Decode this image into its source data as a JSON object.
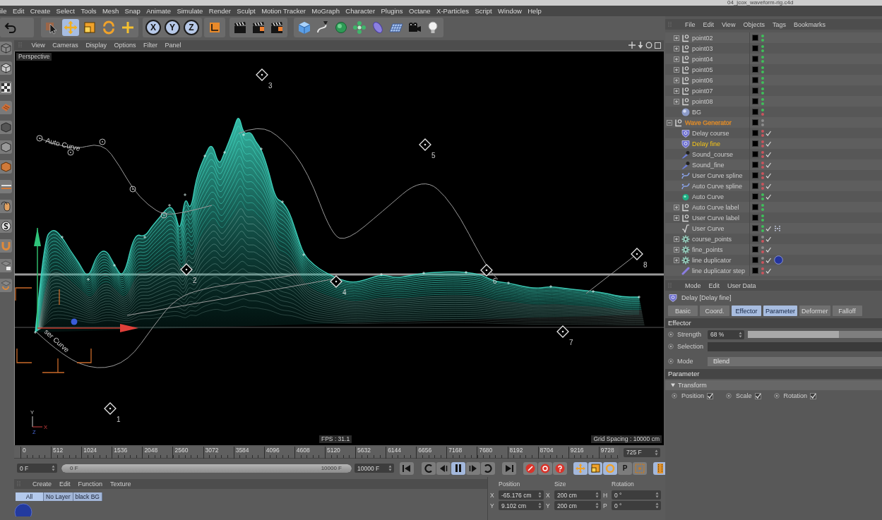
{
  "window": {
    "title": "04_jcox_waveform-rig.c4d"
  },
  "menu_bar": [
    "ile",
    "Edit",
    "Create",
    "Select",
    "Tools",
    "Mesh",
    "Snap",
    "Animate",
    "Simulate",
    "Render",
    "Sculpt",
    "Motion Tracker",
    "MoGraph",
    "Character",
    "Plugins",
    "Octane",
    "X-Particles",
    "Script",
    "Window",
    "Help"
  ],
  "toolbar": {
    "tools": [
      {
        "kind": "live-selection",
        "selected": false
      },
      {
        "kind": "move",
        "selected": true
      },
      {
        "kind": "scale",
        "selected": false
      },
      {
        "kind": "rotate",
        "selected": false
      },
      {
        "kind": "add",
        "selected": false
      }
    ],
    "axis_locks": [
      {
        "label": "X",
        "on": true
      },
      {
        "label": "Y",
        "on": true
      },
      {
        "label": "Z",
        "on": true
      }
    ]
  },
  "viewport": {
    "menu": [
      "View",
      "Cameras",
      "Display",
      "Options",
      "Filter",
      "Panel"
    ],
    "camera": "Perspective",
    "curve_labels": [
      "Auto Curve",
      "ser Curve"
    ],
    "markers": [
      "1",
      "2",
      "3",
      "4",
      "5",
      "6",
      "7",
      "8"
    ],
    "axis_labels": [
      "Y",
      "X",
      "Z"
    ],
    "fps": "FPS : 31.1",
    "grid_spacing": "Grid Spacing : 10000 cm"
  },
  "timeline": {
    "ticks": [
      "0",
      "512",
      "1024",
      "1536",
      "2048",
      "2560",
      "3072",
      "3584",
      "4096",
      "4608",
      "5120",
      "5632",
      "6144",
      "6656",
      "7168",
      "7680",
      "8192",
      "8704",
      "9216",
      "9728"
    ],
    "current_frame": "725 F"
  },
  "transport": {
    "start_frame": "0 F",
    "range": {
      "start": "0 F",
      "end": "10000 F",
      "level": 1
    },
    "end_frame": "10000 F",
    "buttons": [
      {
        "kind": "first-frame",
        "on": false
      },
      {
        "kind": "previous-key",
        "on": false
      },
      {
        "kind": "play-backward",
        "on": false
      },
      {
        "kind": "pause",
        "on": true
      },
      {
        "kind": "play-forward",
        "on": false
      },
      {
        "kind": "next-key",
        "on": false
      },
      {
        "kind": "last-frame",
        "on": false
      }
    ],
    "key_channels": [
      {
        "kind": "move",
        "on": true
      },
      {
        "kind": "scale",
        "on": true
      },
      {
        "kind": "rotate",
        "on": true
      },
      {
        "kind": "parameter",
        "label": "P",
        "on": false
      },
      {
        "kind": "points",
        "on": false
      }
    ]
  },
  "materials": {
    "menu": [
      "Create",
      "Edit",
      "Function",
      "Texture"
    ],
    "layers": [
      {
        "label": "All",
        "selected": true
      },
      {
        "label": "No Layer",
        "selected": false
      },
      {
        "label": "black BG",
        "selected": false
      }
    ]
  },
  "coordinates": {
    "headers": [
      "Position",
      "Size",
      "Rotation"
    ],
    "rows": [
      [
        {
          "axis": "X",
          "value": "-65.176 cm"
        },
        {
          "axis": "X",
          "value": "200 cm"
        },
        {
          "axis": "H",
          "value": "0 °"
        }
      ],
      [
        {
          "axis": "Y",
          "value": "9.102 cm"
        },
        {
          "axis": "Y",
          "value": "200 cm"
        },
        {
          "axis": "P",
          "value": "0 °"
        }
      ]
    ]
  },
  "objects": {
    "menu": [
      "File",
      "Edit",
      "View",
      "Objects",
      "Tags",
      "Bookmarks"
    ],
    "tree": [
      {
        "children": [
          {
            "name": "point02",
            "kind": "null",
            "expanded": false,
            "selected": false,
            "visibility": [
              {
                "color": "#3fbf5a"
              },
              {
                "color": "#3fbf5a"
              }
            ]
          },
          {
            "name": "point03",
            "kind": "null",
            "expanded": false,
            "selected": false,
            "visibility": [
              {
                "color": "#3fbf5a"
              },
              {
                "color": "#3fbf5a"
              }
            ]
          },
          {
            "name": "point04",
            "kind": "null",
            "expanded": false,
            "selected": false,
            "visibility": [
              {
                "color": "#3fbf5a"
              },
              {
                "color": "#3fbf5a"
              }
            ]
          },
          {
            "name": "point05",
            "kind": "null",
            "expanded": false,
            "selected": false,
            "visibility": [
              {
                "color": "#3fbf5a"
              },
              {
                "color": "#3fbf5a"
              }
            ]
          },
          {
            "name": "point06",
            "kind": "null",
            "expanded": false,
            "selected": false,
            "visibility": [
              {
                "color": "#3fbf5a"
              },
              {
                "color": "#3fbf5a"
              }
            ]
          },
          {
            "name": "point07",
            "kind": "null",
            "expanded": false,
            "selected": false,
            "visibility": [
              {
                "color": "#3fbf5a"
              },
              {
                "color": "#3fbf5a"
              }
            ]
          },
          {
            "name": "point08",
            "kind": "null",
            "expanded": false,
            "selected": false,
            "visibility": [
              {
                "color": "#3fbf5a"
              },
              {
                "color": "#3fbf5a"
              }
            ]
          },
          {
            "name": "BG",
            "kind": "sphere",
            "selected": false,
            "visibility": [
              {
                "color": "#3fbf5a"
              },
              {
                "color": "#c9545d"
              }
            ]
          }
        ]
      },
      {
        "name": "Wave Generator",
        "kind": "null",
        "expanded": true,
        "selected": false,
        "color": "#d8892c",
        "visibility": [
          {
            "color": "#8c8c8c"
          },
          {
            "color": "#8c8c8c"
          }
        ],
        "children": [
          {
            "name": "Delay course",
            "kind": "effector",
            "selected": false,
            "visibility": [
              {
                "color": "#c9545d"
              },
              {
                "color": "#c9545d"
              }
            ],
            "enabled": true
          },
          {
            "name": "Delay fine",
            "kind": "effector",
            "selected": true,
            "visibility": [
              {
                "color": "#c9545d"
              },
              {
                "color": "#c9545d"
              }
            ],
            "enabled": true
          },
          {
            "name": "Sound_course",
            "kind": "sound",
            "selected": false,
            "visibility": [
              {
                "color": "#c9545d"
              },
              {
                "color": "#c9545d"
              }
            ],
            "enabled": true
          },
          {
            "name": "Sound_fine",
            "kind": "sound",
            "selected": false,
            "visibility": [
              {
                "color": "#c9545d"
              },
              {
                "color": "#c9545d"
              }
            ],
            "enabled": true
          },
          {
            "name": "User Curve spline",
            "kind": "spline",
            "selected": false,
            "visibility": [
              {
                "color": "#c9545d"
              },
              {
                "color": "#c9545d"
              }
            ],
            "enabled": true
          },
          {
            "name": "Auto Curve spline",
            "kind": "spline",
            "selected": false,
            "visibility": [
              {
                "color": "#c9545d"
              },
              {
                "color": "#c9545d"
              }
            ],
            "enabled": true
          },
          {
            "name": "Auto Curve",
            "kind": "ball",
            "selected": false,
            "visibility": [
              {
                "color": "#3fbf5a"
              },
              {
                "color": "#3fbf5a"
              }
            ],
            "enabled": true
          },
          {
            "name": "Auto Curve label",
            "kind": "null",
            "expanded": false,
            "selected": false,
            "visibility": [
              {
                "color": "#3fbf5a"
              },
              {
                "color": "#3fbf5a"
              }
            ]
          },
          {
            "name": "User Curve label",
            "kind": "null",
            "expanded": false,
            "selected": false,
            "visibility": [
              {
                "color": "#3fbf5a"
              },
              {
                "color": "#3fbf5a"
              }
            ]
          },
          {
            "name": "User Curve",
            "kind": "formula",
            "selected": false,
            "visibility": [
              {
                "color": "#3fbf5a"
              },
              {
                "color": "#3fbf5a"
              }
            ],
            "enabled": true,
            "tags": [
              {
                "kind": "points"
              }
            ]
          },
          {
            "name": "course_points",
            "kind": "gear",
            "expanded": false,
            "selected": false,
            "visibility": [
              {
                "color": "#8c8c8c"
              },
              {
                "color": "#c9545d"
              }
            ],
            "enabled": true
          },
          {
            "name": "fine_points",
            "kind": "gear",
            "expanded": false,
            "selected": false,
            "visibility": [
              {
                "color": "#8c8c8c"
              },
              {
                "color": "#c9545d"
              }
            ],
            "enabled": true
          },
          {
            "name": "line duplicator",
            "kind": "gear",
            "expanded": false,
            "selected": false,
            "visibility": [
              {
                "color": "#8c8c8c"
              },
              {
                "color": "#c9545d"
              }
            ],
            "enabled": true,
            "tags": [
              {
                "kind": "material"
              }
            ]
          },
          {
            "name": "line duplicator step",
            "kind": "stroke",
            "selected": false,
            "visibility": [
              {
                "color": "#c9545d"
              },
              {
                "color": "#c9545d"
              }
            ],
            "enabled": true
          }
        ]
      }
    ]
  },
  "attributes": {
    "menu": [
      "Mode",
      "Edit",
      "User Data"
    ],
    "title": "Delay [Delay fine]",
    "tabs": [
      {
        "label": "Basic",
        "selected": false
      },
      {
        "label": "Coord.",
        "selected": false
      },
      {
        "label": "Effector",
        "selected": true
      },
      {
        "label": "Parameter",
        "selected": true
      },
      {
        "label": "Deformer",
        "selected": false
      },
      {
        "label": "Falloff",
        "selected": false
      }
    ],
    "sections": [
      {
        "title": "Effector",
        "fields": [
          {
            "kind": "slider",
            "label": "Strength",
            "value": "68 %",
            "level": 0.68
          },
          {
            "kind": "link",
            "label": "Selection"
          },
          {
            "kind": "dropdown",
            "label": "Mode",
            "value": "Blend"
          }
        ]
      },
      {
        "title": "Parameter",
        "groups": [
          {
            "title": "Transform",
            "expanded": true,
            "checks": [
              {
                "label": "Position",
                "checked": true
              },
              {
                "label": "Scale",
                "checked": true
              },
              {
                "label": "Rotation",
                "checked": true
              }
            ]
          }
        ]
      }
    ]
  }
}
